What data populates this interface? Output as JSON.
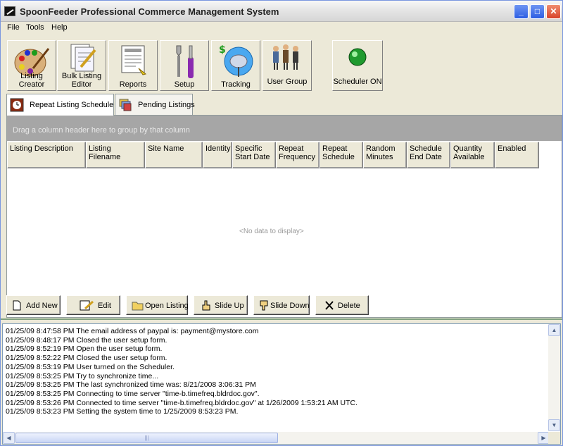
{
  "window": {
    "title": "SpoonFeeder Professional Commerce Management System",
    "controls": {
      "minimize": "_",
      "maximize": "□",
      "close": "✕"
    }
  },
  "menu": {
    "items": [
      "File",
      "Tools",
      "Help"
    ]
  },
  "toolbar": {
    "buttons": [
      {
        "label": "Listing Creator",
        "icon": "palette-icon"
      },
      {
        "label": "Bulk Listing Editor",
        "icon": "document-pencil-icon"
      },
      {
        "label": "Reports",
        "icon": "report-icon"
      },
      {
        "label": "Setup",
        "icon": "tools-icon"
      },
      {
        "label": "Tracking",
        "icon": "satellite-dish-icon"
      },
      {
        "label": "User Group",
        "icon": "people-icon"
      },
      {
        "label": "Scheduler ON",
        "icon": "green-light-icon"
      }
    ]
  },
  "tabs": [
    {
      "label": "Repeat Listing Schedule",
      "active": true
    },
    {
      "label": "Pending Listings",
      "active": false
    }
  ],
  "grid": {
    "group_hint": "Drag a column header here to group by that column",
    "columns": [
      "Listing Description",
      "Listing Filename",
      "Site Name",
      "Identity",
      "Specific Start Date",
      "Repeat Frequency",
      "Repeat Schedule",
      "Random Minutes",
      "Schedule End Date",
      "Quantity Available",
      "Enabled"
    ],
    "empty_text": "<No data to display>"
  },
  "actions": [
    "Add New",
    "Edit",
    "Open Listing",
    "Slide Up",
    "Slide Down",
    "Delete"
  ],
  "log": [
    "01/25/09 8:47:58 PM The email address of paypal is: payment@mystore.com",
    "01/25/09 8:48:17 PM Closed the user setup form.",
    "01/25/09 8:52:19 PM Open the user setup form.",
    "01/25/09 8:52:22 PM Closed the user setup form.",
    "01/25/09 8:53:19 PM User turned on the Scheduler.",
    "01/25/09 8:53:25 PM Try to synchronize time...",
    "01/25/09 8:53:25 PM The last synchronized time was: 8/21/2008 3:06:31 PM",
    "01/25/09 8:53:25 PM Connecting to time server \"time-b.timefreq.bldrdoc.gov\".",
    "01/25/09 8:53:26 PM Connected to time server \"time-b.timefreq.bldrdoc.gov\" at 1/26/2009 1:53:21 AM UTC.",
    "01/25/09 8:53:23 PM Setting the system time to 1/25/2009 8:53:23 PM."
  ],
  "colors": {
    "accent": "#2d5ee3",
    "group_bar": "#a6a6a6",
    "scheduler_light": "#1f9a2e"
  }
}
